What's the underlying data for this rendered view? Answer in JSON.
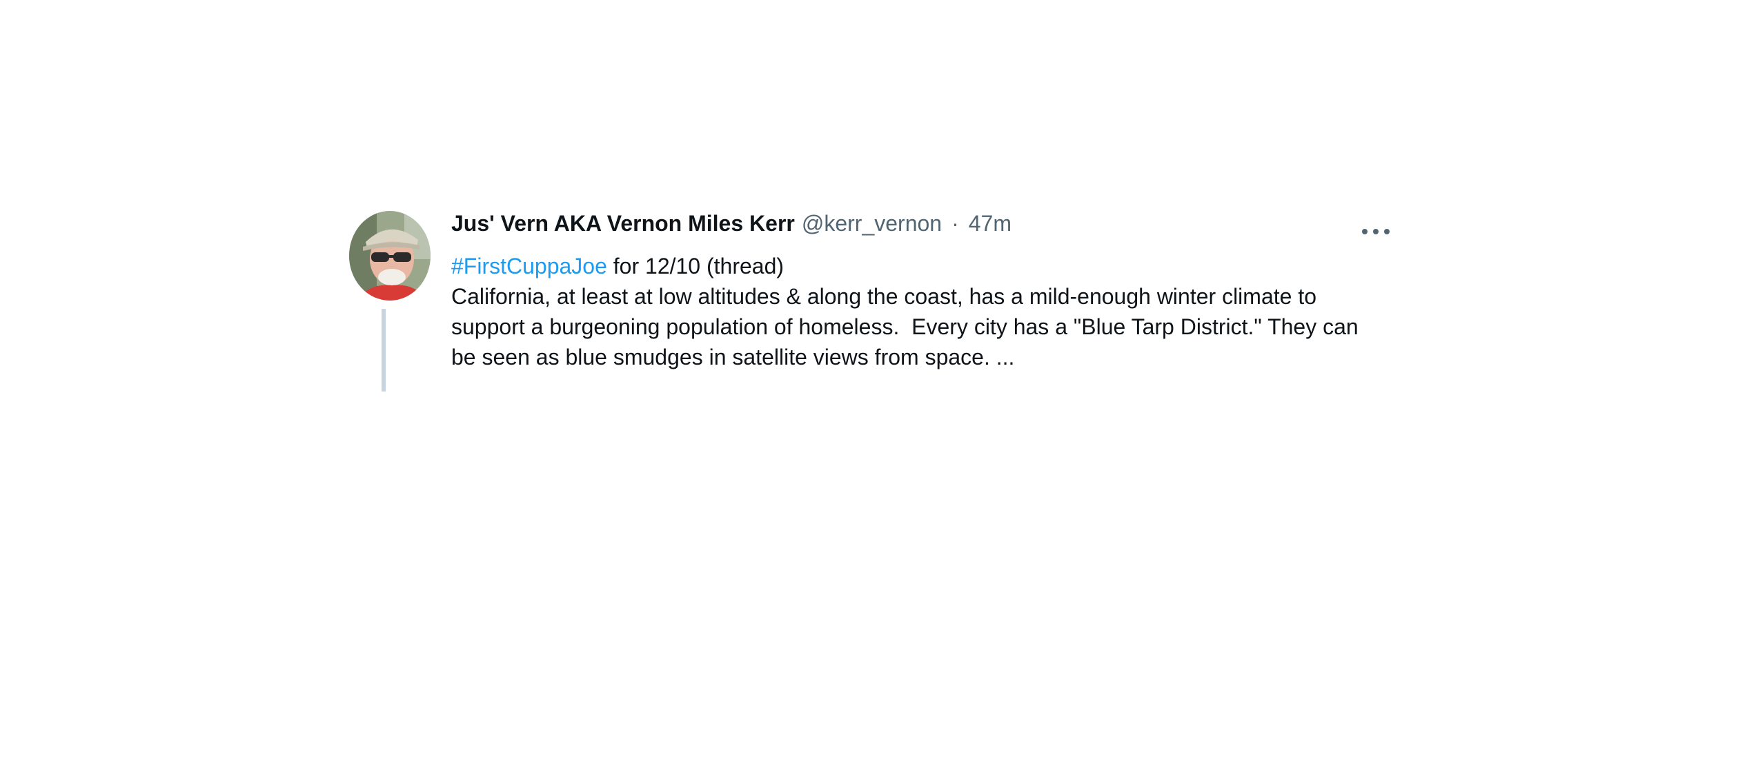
{
  "tweet": {
    "display_name": "Jus' Vern AKA Vernon Miles Kerr",
    "handle": "@kerr_vernon",
    "separator": "·",
    "timestamp": "47m",
    "more_icon": "more-horizontal-icon",
    "hashtag": "#FirstCuppaJoe",
    "first_line_rest": " for 12/10 (thread)",
    "body_lines": [
      "California, at least at low altitudes & along the coast, has a mild-enough winter climate to",
      "support a burgeoning population of homeless.  Every city has a \"Blue Tarp District.\" They can",
      "be seen as blue smudges in satellite views from space. ..."
    ]
  },
  "colors": {
    "text": "#0f1419",
    "secondary": "#536471",
    "link": "#1d9bf0",
    "thread_line": "#c7d3de"
  }
}
